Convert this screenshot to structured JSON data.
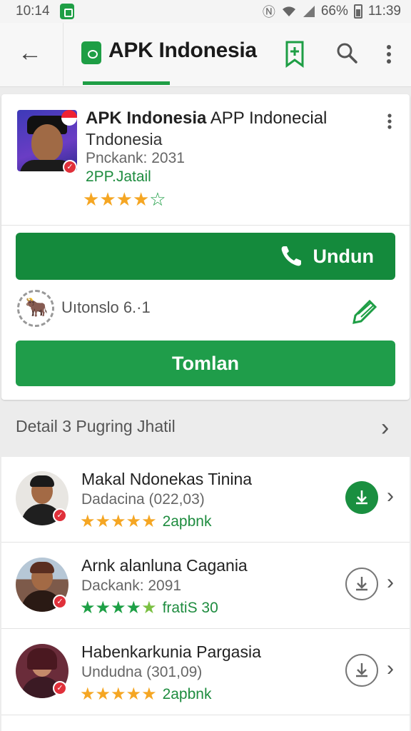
{
  "status_bar": {
    "time": "10:14",
    "battery": "66%",
    "clock": "11:39"
  },
  "app_bar": {
    "title": "APK Indonesia"
  },
  "app_card": {
    "name_bold": "APK Indonesia",
    "name_rest": "APP Indonecial",
    "subtitle": "Tndonesia",
    "meta": "Pnckank: 2031",
    "detail_link": "2PP.Jatail",
    "rating": {
      "filled": 4,
      "total": 5
    },
    "primary_button": "Undun",
    "version": "Uıtonslo 6.·1",
    "secondary_button": "Tomlan"
  },
  "section": {
    "label": "Detail 3 Pugring Jhatil"
  },
  "list": [
    {
      "title": "Makal Ndonekas Tinina",
      "subtitle": "Dadacina (022,03)",
      "tag": "2apbnk",
      "stars": [
        "full",
        "full",
        "full",
        "full",
        "full"
      ],
      "download": "filled"
    },
    {
      "title": "Arnk alanluna Cagania",
      "subtitle": "Dackank: 2091",
      "tag": "fratiS 30",
      "stars": [
        "green",
        "green",
        "green",
        "green",
        "lime"
      ],
      "download": "outline"
    },
    {
      "title": "Habenkarkunia Pargasia",
      "subtitle": "Undudna (301,09)",
      "tag": "2apbnk",
      "stars": [
        "full",
        "full",
        "full",
        "full",
        "full"
      ],
      "download": "outline"
    }
  ]
}
